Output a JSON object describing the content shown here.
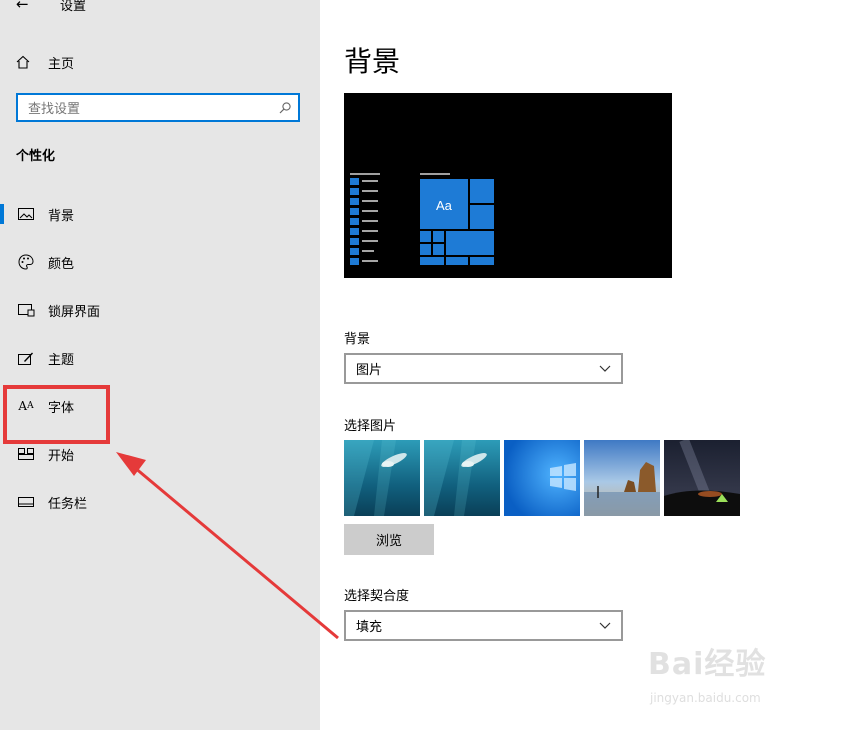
{
  "window": {
    "back_glyph": "←",
    "title": "设置"
  },
  "sidebar": {
    "home_label": "主页",
    "search_placeholder": "查找设置",
    "section_title": "个性化",
    "items": [
      {
        "label": "背景",
        "icon": "picture-icon",
        "active": true
      },
      {
        "label": "颜色",
        "icon": "palette-icon"
      },
      {
        "label": "锁屏界面",
        "icon": "lock-screen-icon"
      },
      {
        "label": "主题",
        "icon": "theme-brush-icon"
      },
      {
        "label": "字体",
        "icon": "font-icon",
        "highlighted": true
      },
      {
        "label": "开始",
        "icon": "start-menu-icon"
      },
      {
        "label": "任务栏",
        "icon": "taskbar-icon"
      }
    ],
    "font_icon_glyph": "Aᴀ"
  },
  "main": {
    "page_title": "背景",
    "preview_tile_text": "Aa",
    "background_label": "背景",
    "background_value": "图片",
    "choose_picture_label": "选择图片",
    "browse_label": "浏览",
    "fit_label": "选择契合度",
    "fit_value": "填充"
  },
  "watermark": {
    "logo": "Bai经验",
    "url": "jingyan.baidu.com"
  },
  "colors": {
    "accent": "#0078d7",
    "annotation": "#e53a3a",
    "sidebar_bg": "#e6e6e6"
  }
}
